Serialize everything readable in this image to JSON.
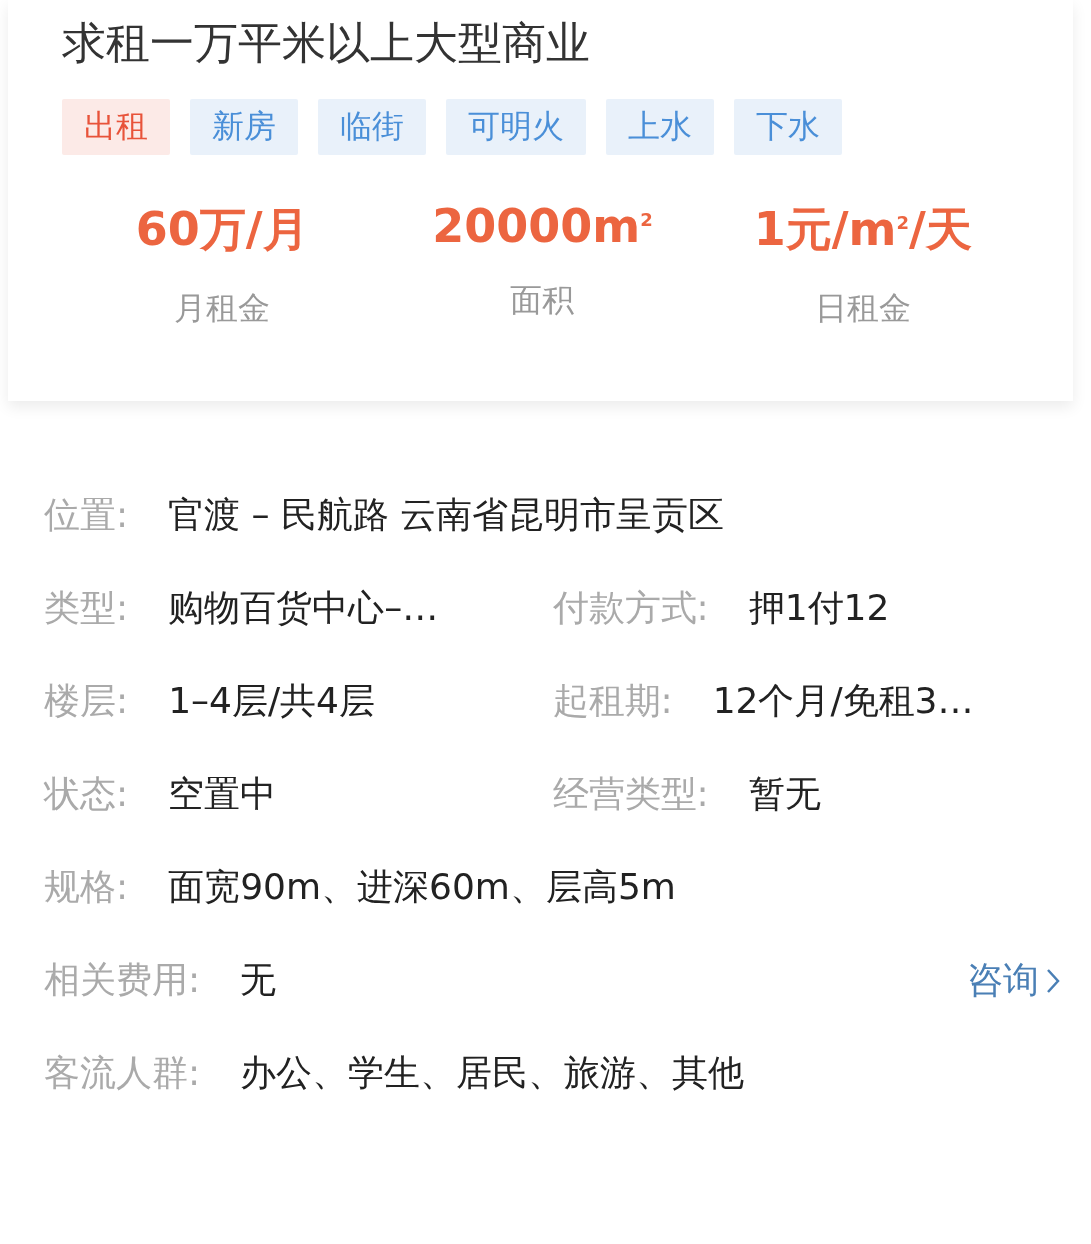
{
  "title": "求租一万平米以上大型商业",
  "tags": [
    {
      "label": "出租",
      "color": "#e8533a"
    },
    {
      "label": "新房",
      "color": "#4a8fd8"
    },
    {
      "label": "临街",
      "color": "#4a8fd8"
    },
    {
      "label": "可明火",
      "color": "#4a8fd8"
    },
    {
      "label": "上水",
      "color": "#4a8fd8"
    },
    {
      "label": "下水",
      "color": "#4a8fd8"
    }
  ],
  "stats": [
    {
      "value": "60万/月",
      "label": "月租金"
    },
    {
      "value": "20000m$^{2}$",
      "label": "面积"
    },
    {
      "value": "1元/m$^{2}$/天",
      "label": "日租金"
    }
  ],
  "details": [
    {
      "fields": [
        {
          "label": "位置:",
          "value": "官渡 – 民航路 云南省昆明市呈贡区"
        }
      ]
    },
    {
      "fields": [
        {
          "label": "类型:",
          "value": "购物百货中心–…"
        },
        {
          "label": "付款方式:",
          "value": "押1付12"
        }
      ]
    },
    {
      "fields": [
        {
          "label": "楼层:",
          "value": "1–4层/共4层"
        },
        {
          "label": "起租期:",
          "value": "12个月/免租3…"
        }
      ]
    },
    {
      "fields": [
        {
          "label": "状态:",
          "value": "空置中"
        },
        {
          "label": "经营类型:",
          "value": "暂无"
        }
      ]
    },
    {
      "fields": [
        {
          "label": "规格:",
          "value": "面宽90m、进深60m、层高5m"
        }
      ]
    },
    {
      "fields": [
        {
          "label": "相关费用:",
          "value": "无"
        }
      ],
      "action": "咨询"
    },
    {
      "fields": [
        {
          "label": "客流人群:",
          "value": "办公、学生、居民、旅游、其他"
        }
      ]
    }
  ]
}
